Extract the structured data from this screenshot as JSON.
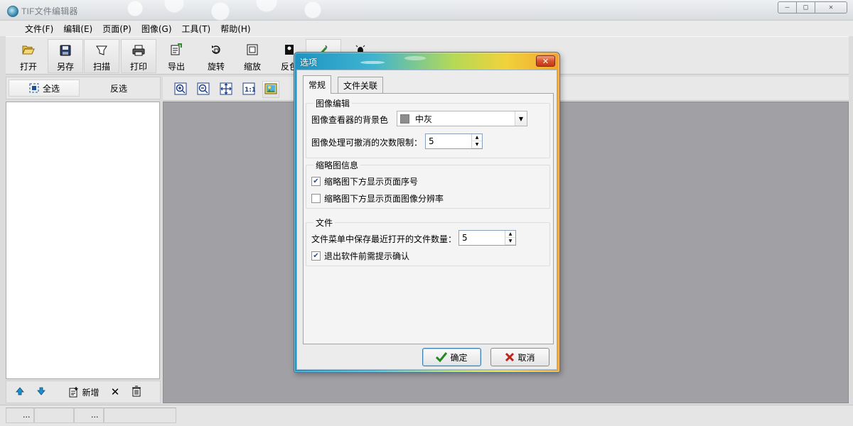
{
  "window": {
    "title": "TIF文件编辑器",
    "controls": {
      "minimize": "▭",
      "maximize": "□",
      "close": "✕"
    }
  },
  "menu": [
    "文件(F)",
    "编辑(E)",
    "页面(P)",
    "图像(G)",
    "工具(T)",
    "帮助(H)"
  ],
  "toolbar": {
    "open": "打开",
    "save_as": "另存",
    "scan": "扫描",
    "print": "打印",
    "export": "导出",
    "rotate": "旋转",
    "zoom": "缩放",
    "invert": "反色"
  },
  "selection": {
    "select_all": "全选",
    "invert_select": "反选"
  },
  "left_footer": {
    "add": "新增"
  },
  "status": {
    "cell1": "...",
    "cell2": "..."
  },
  "dialog": {
    "title": "选项",
    "close": "✕",
    "tabs": [
      "常规",
      "文件关联"
    ],
    "groups": {
      "image_edit": {
        "title": "图像编辑",
        "bg_label": "图像查看器的背景色",
        "bg_value": "中灰",
        "undo_label": "图像处理可撤消的次数限制：",
        "undo_value": "5"
      },
      "thumb": {
        "title": "缩略图信息",
        "show_page_no": "缩略图下方显示页面序号",
        "show_page_no_checked": true,
        "show_resolution": "缩略图下方显示页面图像分辨率",
        "show_resolution_checked": false
      },
      "file": {
        "title": "文件",
        "recent_label": "文件菜单中保存最近打开的文件数量：",
        "recent_value": "5",
        "confirm_exit": "退出软件前需提示确认",
        "confirm_exit_checked": true
      }
    },
    "ok": "确定",
    "cancel": "取消"
  },
  "colors": {
    "canvas_bg": "#a1a0a4",
    "dialog_gradient_start": "#1e94c4",
    "dialog_gradient_end": "#f2a330",
    "swatch": "#8d8d8d"
  }
}
